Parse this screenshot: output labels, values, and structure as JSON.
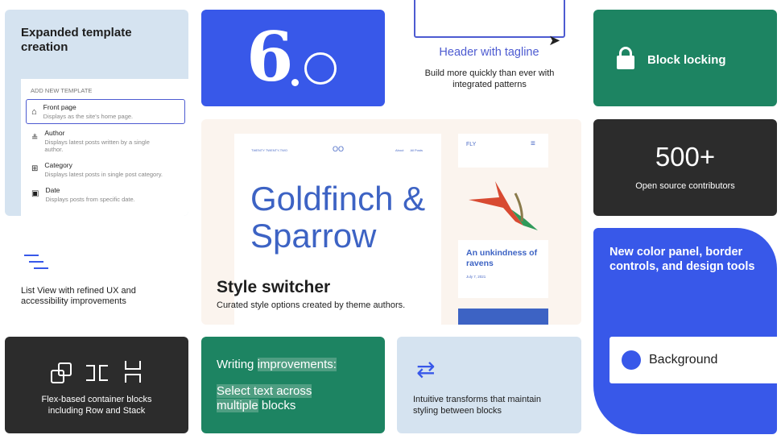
{
  "template_card": {
    "title": "Expanded template creation",
    "panel_heading": "ADD NEW TEMPLATE",
    "items": [
      {
        "icon": "home-icon",
        "label": "Front page",
        "desc": "Displays as the site's home page."
      },
      {
        "icon": "author-icon",
        "label": "Author",
        "desc": "Displays latest posts written by a single author."
      },
      {
        "icon": "category-icon",
        "label": "Category",
        "desc": "Displays latest posts in single post category."
      },
      {
        "icon": "calendar-icon",
        "label": "Date",
        "desc": "Displays posts from specific date."
      }
    ]
  },
  "version_card": {
    "major": "6",
    "minor": "o"
  },
  "patterns_card": {
    "title": "Header with tagline",
    "desc": "Build more quickly than ever with integrated patterns"
  },
  "locking_card": {
    "icon": "lock-icon",
    "label": "Block locking"
  },
  "style_card": {
    "site_name": "TWENTY TWENTY-TWO",
    "nav": [
      "About",
      "All Posts"
    ],
    "hero": "Goldfinch & Sparrow",
    "mobile_brand": "FLY",
    "post_title": "An unkindness of ravens",
    "post_date": "July 7, 2021",
    "title": "Style switcher",
    "desc": "Curated style options created by theme authors."
  },
  "contributors_card": {
    "count": "500+",
    "label": "Open source contributors"
  },
  "listview_card": {
    "icon": "list-view-icon",
    "desc": "List View with refined UX and accessibility improvements"
  },
  "color_card": {
    "title": "New color panel, border controls, and design tools",
    "swatch_label": "Background",
    "swatch_color": "#3858e9"
  },
  "flex_card": {
    "desc": "Flex-based container blocks including Row and Stack"
  },
  "writing_card": {
    "line1a": "Writing ",
    "line1b": "improvements:",
    "line2a": "Select text across",
    "line3a": "multiple",
    "line3b": " blocks"
  },
  "transform_card": {
    "icon": "transform-icon",
    "desc": "Intuitive transforms that maintain styling between blocks"
  },
  "colors": {
    "blue": "#3858e9",
    "green": "#1d8462",
    "dark": "#2c2c2c",
    "light_blue": "#d5e3f0",
    "cream": "#fbf4ee"
  }
}
